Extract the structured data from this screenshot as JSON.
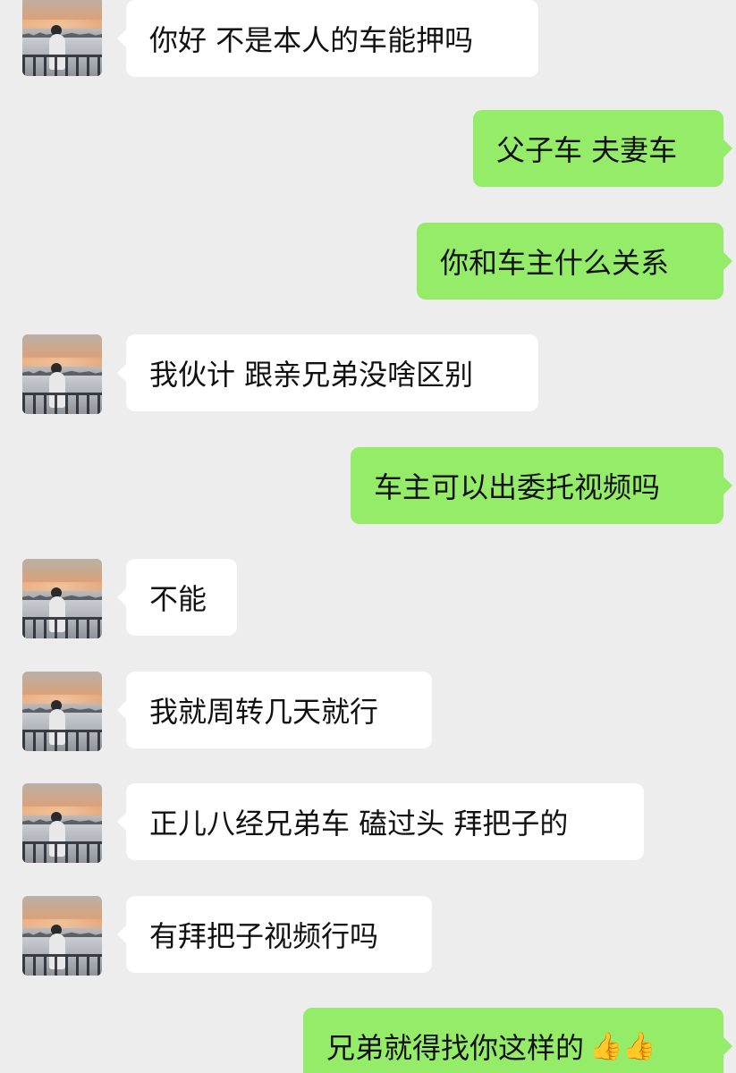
{
  "chat": {
    "messages": [
      {
        "side": "in",
        "text": "你好 不是本人的车能押吗"
      },
      {
        "side": "out",
        "text": "父子车 夫妻车"
      },
      {
        "side": "out",
        "text": "你和车主什么关系"
      },
      {
        "side": "in",
        "text": "我伙计 跟亲兄弟没啥区别"
      },
      {
        "side": "out",
        "text": "车主可以出委托视频吗"
      },
      {
        "side": "in",
        "text": "不能"
      },
      {
        "side": "in",
        "text": "我就周转几天就行"
      },
      {
        "side": "in",
        "text": "正儿八经兄弟车 磕过头 拜把子的"
      },
      {
        "side": "in",
        "text": "有拜把子视频行吗"
      },
      {
        "side": "out",
        "text": "兄弟就得找你这样的",
        "emoji": "👍👍"
      }
    ]
  },
  "colors": {
    "background": "#ededed",
    "incoming_bubble": "#ffffff",
    "outgoing_bubble": "#95ec69"
  },
  "icons": {
    "avatar": "avatar-image",
    "thumbs_up": "thumbs-up-icon"
  }
}
